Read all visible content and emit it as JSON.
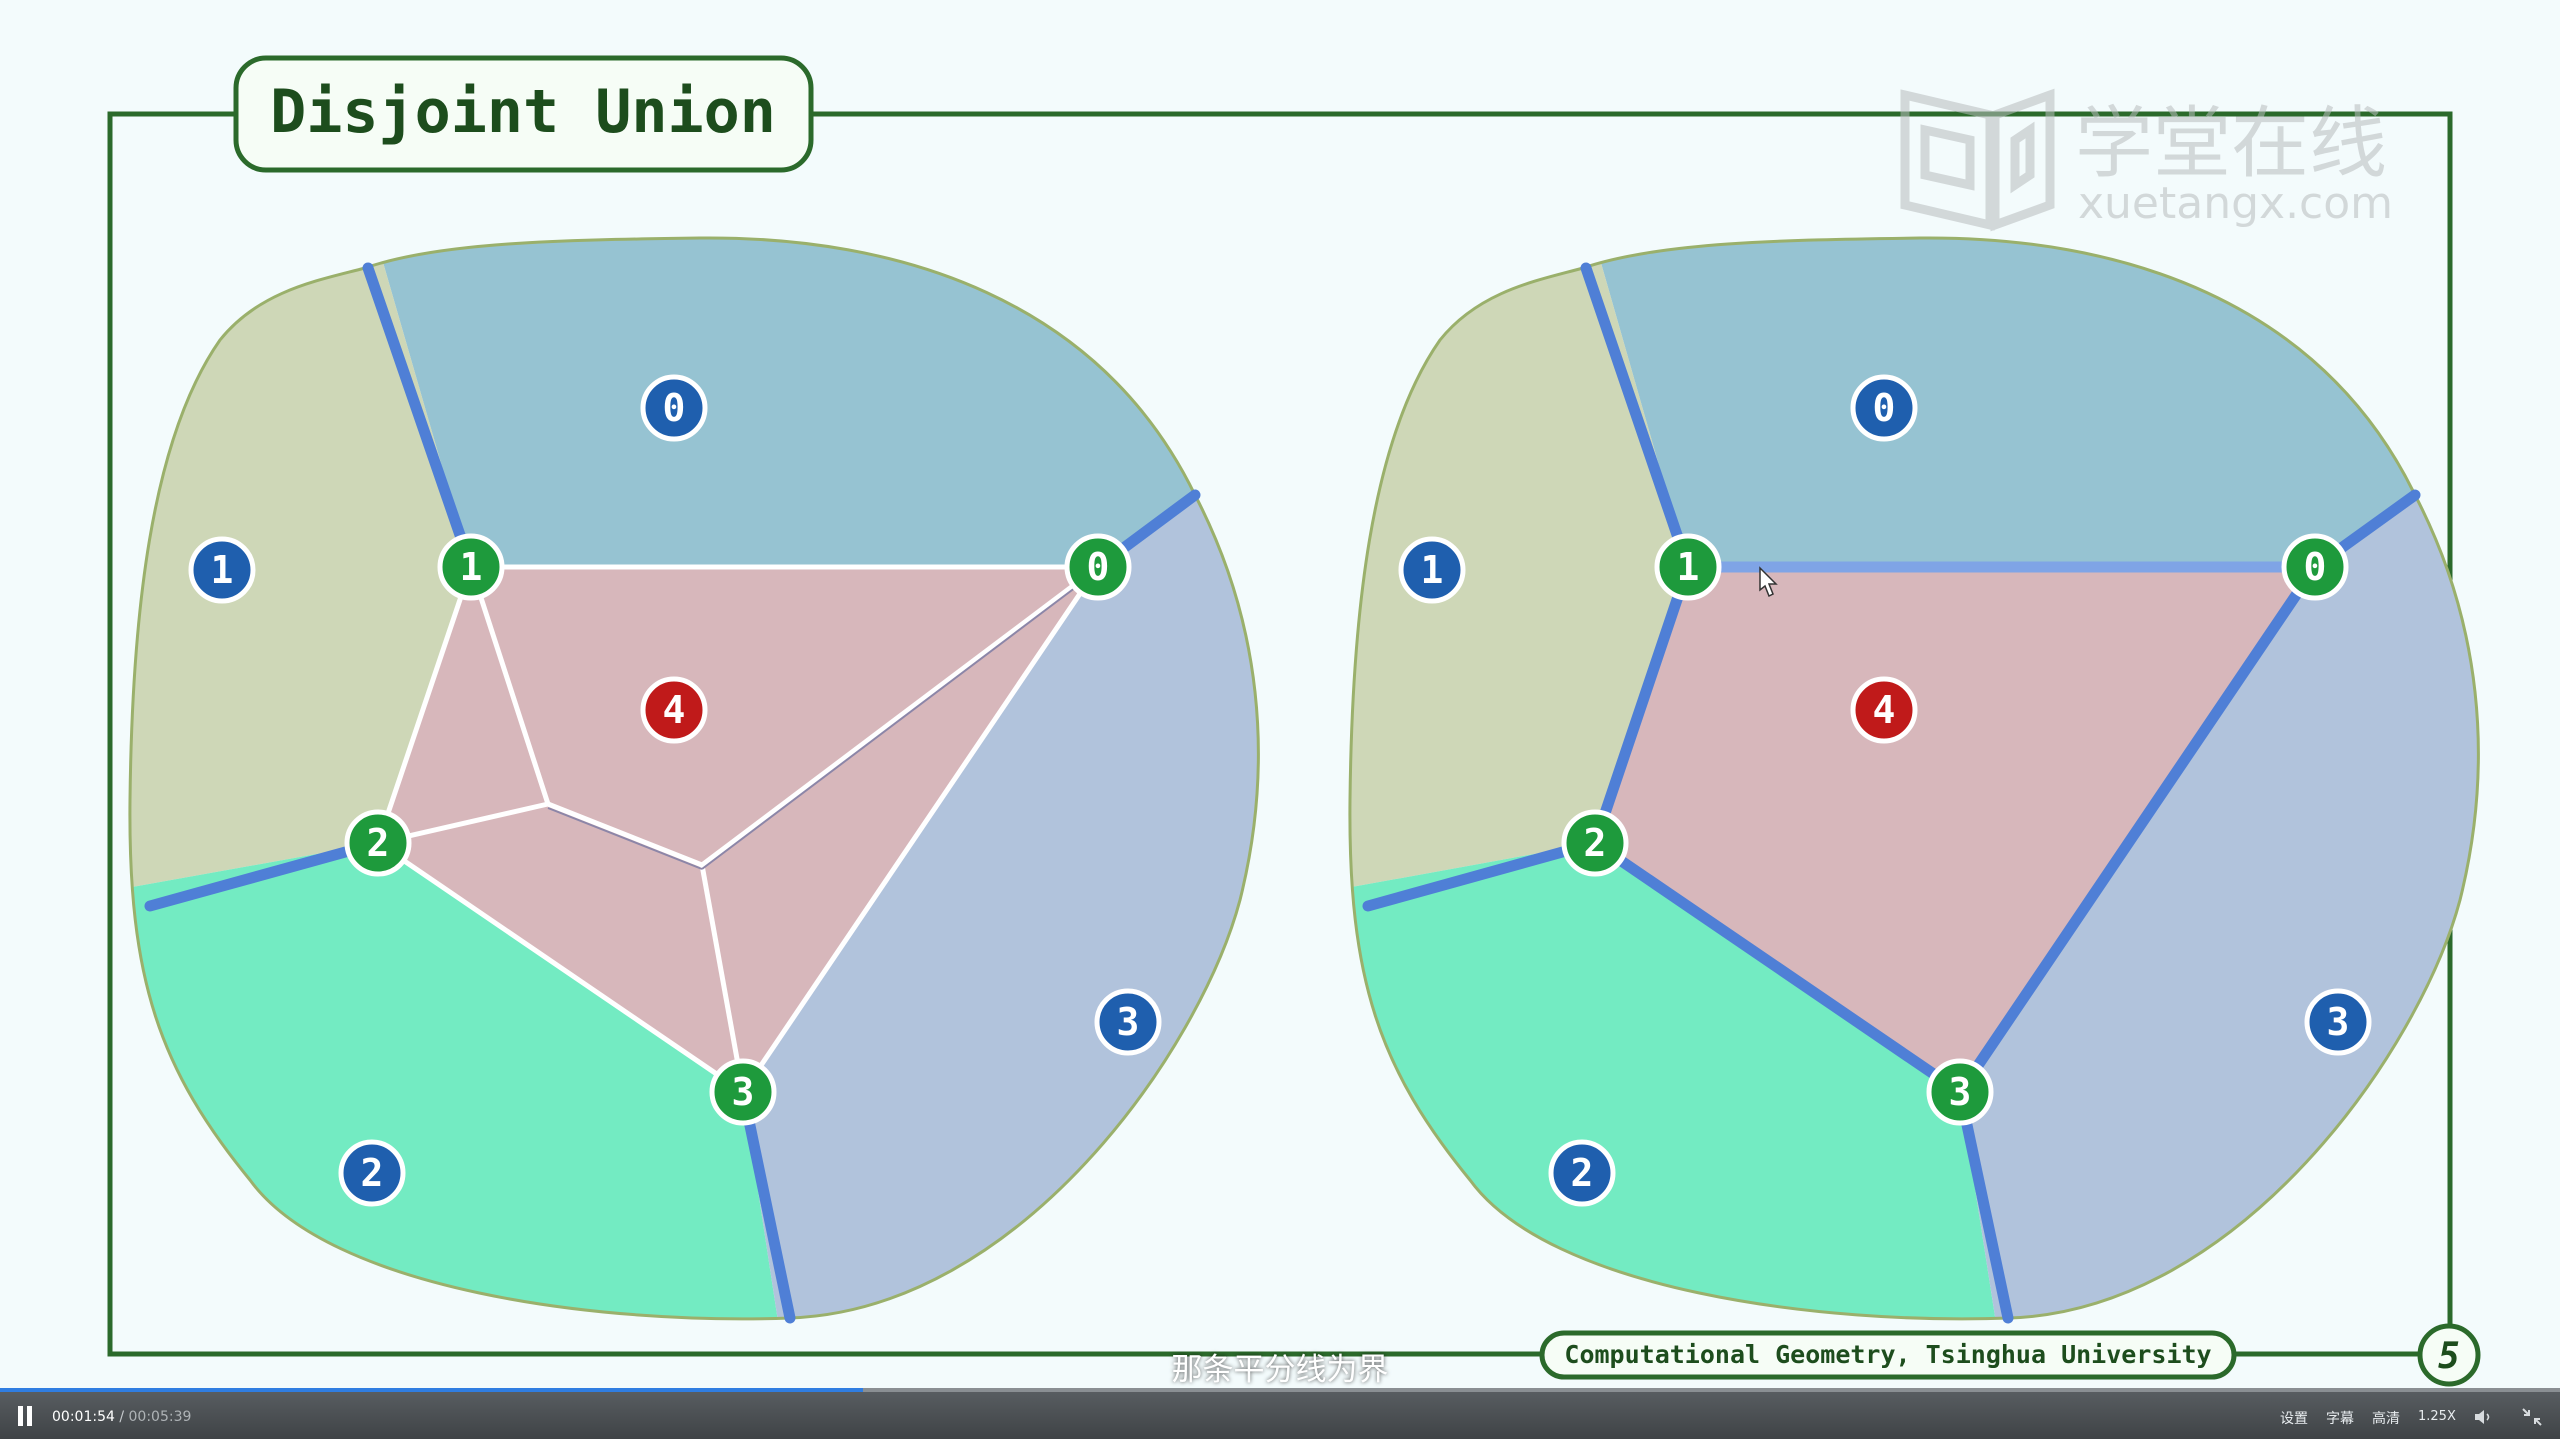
{
  "slide": {
    "title": "Disjoint Union",
    "footer": "Computational Geometry, Tsinghua University",
    "page_number": "5",
    "watermark": {
      "brand": "学堂在线",
      "domain": "xuetangx.com"
    },
    "colors": {
      "frame": "#2b6a2b",
      "region_0": "#96c3d2",
      "region_1": "#ced7b7",
      "region_2": "#73ebc2",
      "region_3": "#b1c3dc",
      "region_4": "#d7b7bb",
      "site_blue": "#1f5fae",
      "site_green": "#1e9a3c",
      "site_red": "#c01a1a",
      "edge_blue": "#4f7fd6"
    },
    "left_diagram": {
      "region_labels": [
        "0",
        "1",
        "2",
        "3",
        "4"
      ],
      "vertex_labels": [
        "0",
        "1",
        "2",
        "3"
      ]
    },
    "right_diagram": {
      "region_labels": [
        "0",
        "1",
        "2",
        "3",
        "4"
      ],
      "vertex_labels": [
        "0",
        "1",
        "2",
        "3"
      ]
    }
  },
  "player": {
    "subtitle": "那条平分线为界",
    "current_time": "00:01:54",
    "separator": "/",
    "duration": "00:05:39",
    "progress": 0.337,
    "settings_label": "设置",
    "captions_label": "字幕",
    "quality_label": "高清",
    "speed_label": "1.25X",
    "volume_icon": "volume-icon",
    "exit_fullscreen_icon": "exit-fullscreen-icon"
  }
}
